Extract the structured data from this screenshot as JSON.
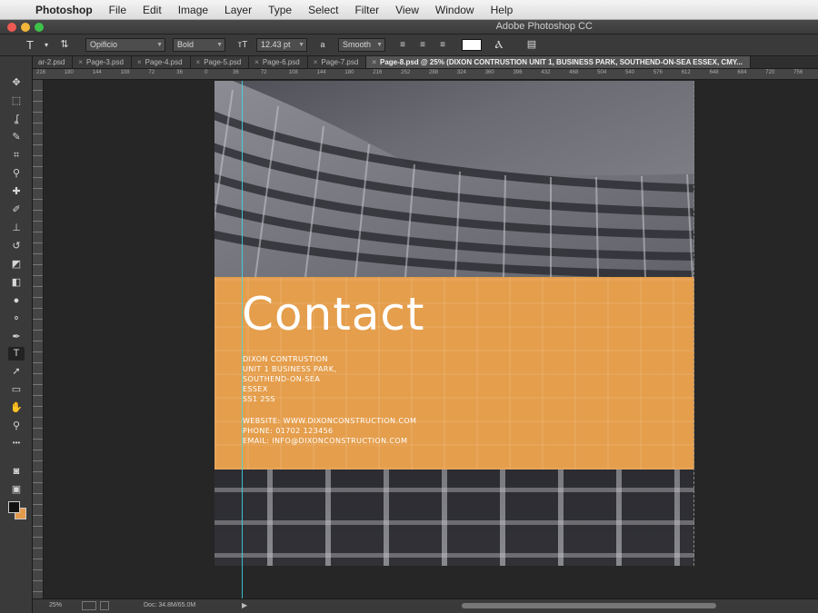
{
  "menubar": {
    "apple": "",
    "items": [
      "Photoshop",
      "File",
      "Edit",
      "Image",
      "Layer",
      "Type",
      "Select",
      "Filter",
      "View",
      "Window",
      "Help"
    ]
  },
  "window": {
    "title": "Adobe Photoshop CC"
  },
  "options": {
    "tool_glyph": "T",
    "font_family": "Opificio",
    "font_style": "Bold",
    "font_size": "12.43 pt",
    "antialias_label": "a",
    "antialias": "Smooth",
    "text_color": "#ffffff"
  },
  "tabs": [
    {
      "label": "ar-2.psd"
    },
    {
      "label": "Page-3.psd"
    },
    {
      "label": "Page-4.psd"
    },
    {
      "label": "Page-5.psd"
    },
    {
      "label": "Page-6.psd"
    },
    {
      "label": "Page-7.psd"
    },
    {
      "label": "Page-8.psd @ 25% (DIXON CONTRUSTION UNIT 1, BUSINESS PARK, SOUTHEND-ON-SEA ESSEX, CMY..."
    }
  ],
  "ruler": {
    "ticks": [
      "216",
      "180",
      "144",
      "108",
      "72",
      "36",
      "0",
      "36",
      "72",
      "108",
      "144",
      "180",
      "216",
      "252",
      "288",
      "324",
      "360",
      "396",
      "432",
      "468",
      "504",
      "540",
      "576",
      "612",
      "648",
      "684",
      "720",
      "756"
    ]
  },
  "document": {
    "title": "Contact",
    "address": [
      "DIXON CONTRUSTION",
      "UNIT 1 BUSINESS PARK,",
      "SOUTHEND-ON-SEA",
      "ESSEX",
      "SS1 2SS"
    ],
    "contacts": [
      "WEBSITE: WWW.DIXONCONSTRUCTION.COM",
      "PHONE: 01702 123456",
      "EMAIL: INFO@DIXONCONSTRUCTION.COM"
    ],
    "banner_color": "#e59e4c"
  },
  "status": {
    "zoom": "25%",
    "doc": "Doc: 34.8M/65.0M"
  },
  "colors": {
    "foreground": "#111111",
    "background": "#e39a4a",
    "guide": "#3fd7e6"
  }
}
